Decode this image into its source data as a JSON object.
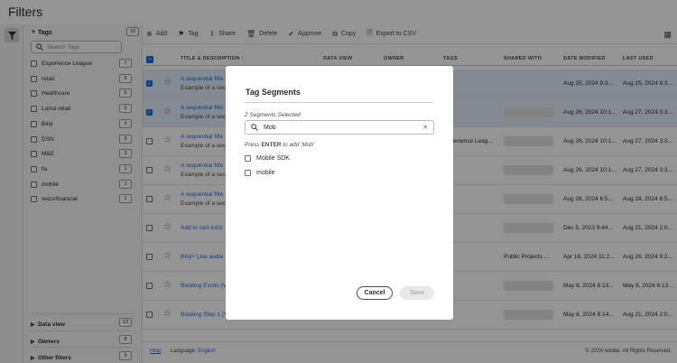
{
  "app": {
    "title": "Filters"
  },
  "filters": {
    "tags": {
      "label": "Tags",
      "count": "10",
      "search_placeholder": "Search Tags",
      "items": [
        {
          "label": "Experience League",
          "count": "7"
        },
        {
          "label": "retail",
          "count": "6"
        },
        {
          "label": "Healthcare",
          "count": "5"
        },
        {
          "label": "Luma retail",
          "count": "5"
        },
        {
          "label": "Binji",
          "count": "3"
        },
        {
          "label": "DSN",
          "count": "3"
        },
        {
          "label": "M&E",
          "count": "3"
        },
        {
          "label": "fsi",
          "count": "1"
        },
        {
          "label": "mobile",
          "count": "1"
        },
        {
          "label": "securfinancial",
          "count": "1"
        }
      ]
    },
    "sections": [
      {
        "label": "Data view",
        "count": "13"
      },
      {
        "label": "Owners",
        "count": "8"
      },
      {
        "label": "Other filters",
        "count": "5"
      }
    ]
  },
  "toolbar": {
    "add": "Add",
    "tag": "Tag",
    "share": "Share",
    "delete": "Delete",
    "approve": "Approve",
    "copy": "Copy",
    "export": "Export to CSV"
  },
  "table": {
    "columns": [
      "TITLE & DESCRIPTION",
      "DATA VIEW",
      "OWNER",
      "TAGS",
      "SHARED WITH",
      "DATE MODIFIED",
      "LAST USED"
    ],
    "rows": [
      {
        "name": "A sequential filte",
        "desc": "Example of a sec",
        "tags": "",
        "shared": "",
        "modified": "Aug 25, 2024 9:3...",
        "used": "Aug 25, 2024 9:3...",
        "selected": true
      },
      {
        "name": "A sequential filte",
        "desc": "Example of a sec",
        "tags": "",
        "shared": "",
        "modified": "Aug 26, 2024 10:1...",
        "used": "Aug 27, 2024 3:3...",
        "selected": true
      },
      {
        "name": "A sequential filte",
        "desc": "Example of a sec",
        "tags": "xperience Leag...",
        "shared": "",
        "modified": "Aug 26, 2024 10:1...",
        "used": "Aug 27, 2024 3:3...",
        "selected": false
      },
      {
        "name": "A sequential filte",
        "desc": "Example of a sec",
        "tags": "",
        "shared": "",
        "modified": "Aug 26, 2024 10:1...",
        "used": "Aug 27, 2024 3:3...",
        "selected": false
      },
      {
        "name": "A sequential filte",
        "desc": "Example of a sec",
        "tags": "",
        "shared": "",
        "modified": "Aug 28, 2024 6:5...",
        "used": "Aug 28, 2024 6:5...",
        "selected": false
      },
      {
        "name": "Add to cart exist",
        "desc": "",
        "tags": "",
        "shared": "",
        "modified": "Dec 5, 2023 9:44...",
        "used": "Aug 21, 2024 2:0...",
        "selected": false
      },
      {
        "name": "Binji+ Live audie",
        "desc": "",
        "tags": "",
        "shared": "Public Projects ...",
        "modified": "Apr 18, 2024 11:2...",
        "used": "Aug 26, 2024 9:2...",
        "selected": false
      },
      {
        "name": "Booking Exists (V",
        "desc": "",
        "tags": "",
        "shared": "",
        "modified": "May 8, 2024 6:13...",
        "used": "May 8, 2024 6:13...",
        "selected": false
      },
      {
        "name": "Booking Step 1 (V",
        "desc": "",
        "tags": "",
        "shared": "",
        "modified": "May 8, 2024 6:14...",
        "used": "Aug 21, 2024 2:0...",
        "selected": false
      }
    ]
  },
  "footer": {
    "help": "Help",
    "language_label": "Language:",
    "language_value": "English",
    "copyright": "© 2024 Adobe. All Rights Reserved."
  },
  "modal": {
    "title": "Tag Segments",
    "selected_count": "2 Segments Selected",
    "search_value": "Mob",
    "hint_prefix": "Press",
    "hint_key": "ENTER",
    "hint_suffix": "to add 'Mob'",
    "options": [
      {
        "label": "Mobile SDK"
      },
      {
        "label": "mobile"
      }
    ],
    "cancel": "Cancel",
    "save": "Save"
  },
  "colors": {
    "accent": "#1473e6",
    "selected_row": "#e4eefa"
  }
}
